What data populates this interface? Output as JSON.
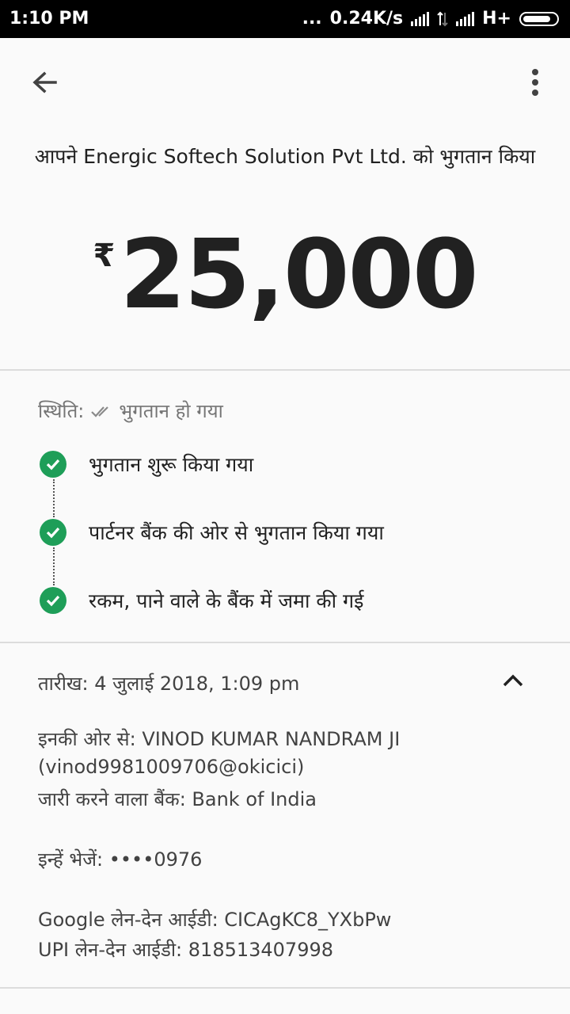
{
  "status_bar": {
    "time": "1:10 PM",
    "dots": "...",
    "speed": "0.24K/s",
    "network": "H+"
  },
  "app_bar": {
    "back_icon": "arrow-back-icon",
    "menu_icon": "more-vert-icon"
  },
  "payment": {
    "title": "आपने Energic Softech Solution Pvt Ltd. को भुगतान किया",
    "currency": "₹",
    "amount": "25,000"
  },
  "status": {
    "label": "स्थिति:",
    "value": "भुगतान हो गया",
    "steps": [
      {
        "label": "भुगतान शुरू किया गया"
      },
      {
        "label": "पार्टनर बैंक की ओर से भुगतान किया गया"
      },
      {
        "label": "रकम, पाने वाले के बैंक में जमा की गई"
      }
    ],
    "accent_color": "#1e9e58"
  },
  "details": {
    "date": "तारीख: 4 जुलाई 2018, 1:09 pm",
    "from": "इनकी ओर से: VINOD KUMAR NANDRAM JI",
    "from_upi": "(vinod9981009706@okicici)",
    "issuing_bank": "जारी करने वाला बैंक: Bank of India",
    "sent_to": "इन्हें भेजें: ••••0976",
    "google_txn_id": "Google लेन-देन आईडी: CICAgKC8_YXbPw",
    "upi_txn_id": "UPI लेन-देन आईडी: 818513407998"
  }
}
